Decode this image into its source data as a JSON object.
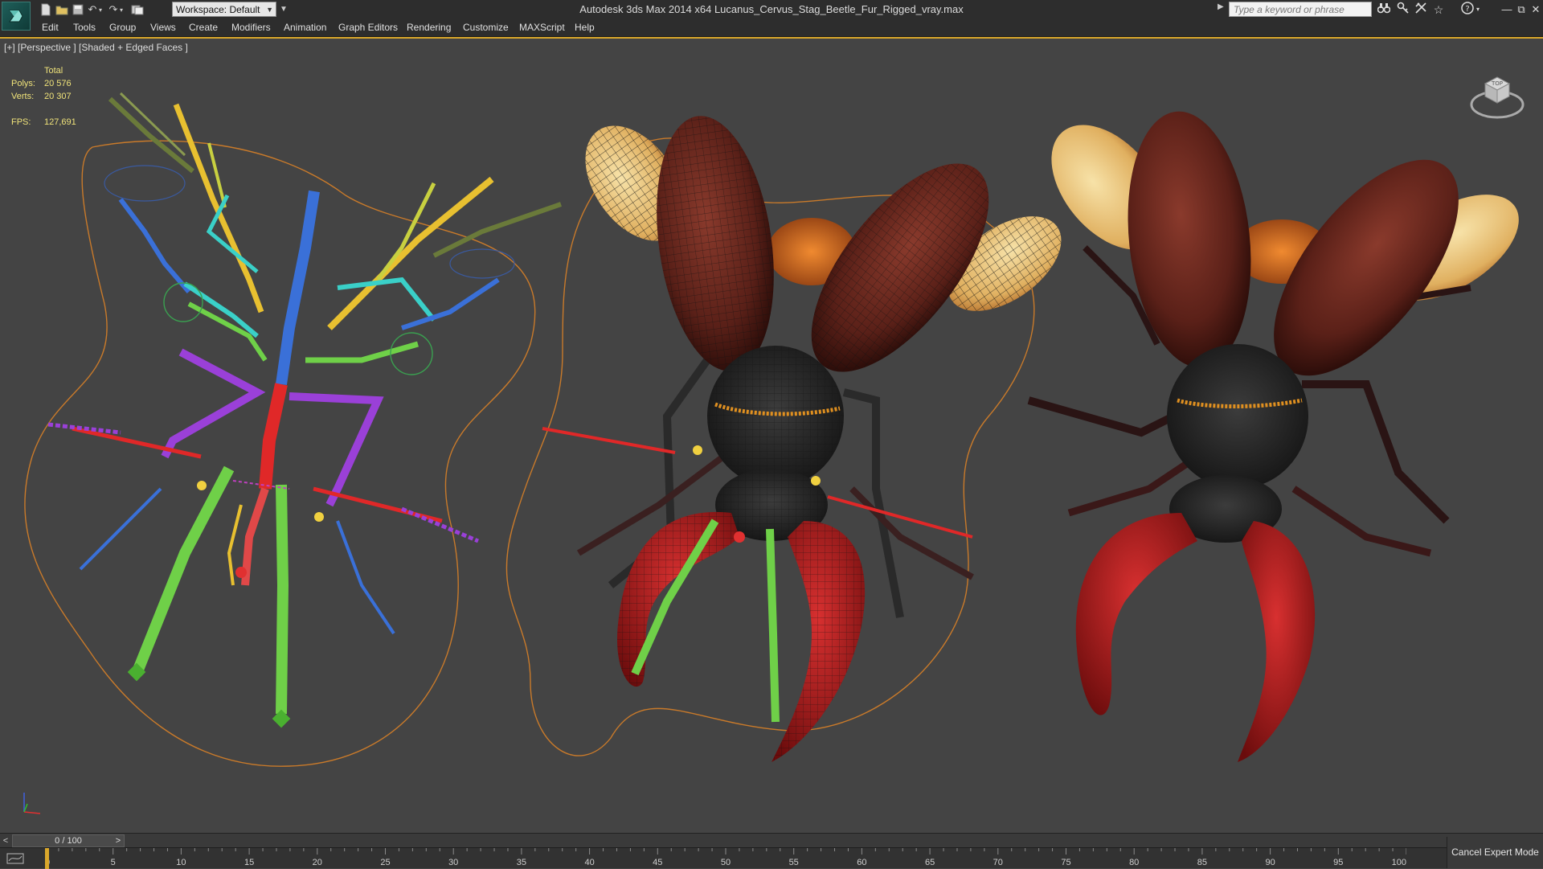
{
  "window": {
    "title": "Autodesk 3ds Max  2014 x64     Lucanus_Cervus_Stag_Beetle_Fur_Rigged_vray.max"
  },
  "quick_access": {
    "workspace_label": "Workspace: Default",
    "icons": [
      "new-file-icon",
      "open-file-icon",
      "save-icon",
      "undo-icon",
      "redo-icon",
      "project-folder-icon"
    ]
  },
  "infocenter": {
    "search_placeholder": "Type a keyword or phrase",
    "icons": [
      "binoculars-icon",
      "subscription-key-icon",
      "communication-icon",
      "favorites-star-icon",
      "help-icon"
    ]
  },
  "window_buttons": [
    "minimize",
    "restore",
    "close"
  ],
  "menu": {
    "items": [
      "Edit",
      "Tools",
      "Group",
      "Views",
      "Create",
      "Modifiers",
      "Animation",
      "Graph Editors",
      "Rendering",
      "Customize",
      "MAXScript",
      "Help"
    ]
  },
  "viewport": {
    "label": "[+] [Perspective ] [Shaded + Edged Faces ]",
    "stats": {
      "total_label": "Total",
      "polys_label": "Polys:",
      "polys_value": "20 576",
      "verts_label": "Verts:",
      "verts_value": "20 307",
      "fps_label": "FPS:",
      "fps_value": "127,691"
    },
    "viewcube_face": "TOP",
    "colors": {
      "background": "#444444",
      "border_active": "#d9a72b",
      "stats_text": "#f0e37a",
      "spline": "#c97a2a",
      "beetle_elytra": "#6b2a20",
      "beetle_mandible": "#b01818",
      "beetle_body": "#2a2a2a",
      "bone_green": "#6fd048",
      "bone_purple": "#9a40d8",
      "bone_yellow": "#e8c030",
      "bone_blue": "#3a70d8",
      "bone_cyan": "#3ad0c8",
      "bone_red": "#e02828"
    }
  },
  "time_slider": {
    "label": "0 / 100",
    "prev": "<",
    "next": ">",
    "current_frame": 0,
    "max_frame": 100
  },
  "track_bar": {
    "ticks": [
      "0",
      "5",
      "10",
      "15",
      "20",
      "25",
      "30",
      "35",
      "40",
      "45",
      "50",
      "55",
      "60",
      "65",
      "70",
      "75",
      "80",
      "85",
      "90",
      "95",
      "100"
    ]
  },
  "status": {
    "cancel_expert_mode": "Cancel Expert Mode"
  }
}
